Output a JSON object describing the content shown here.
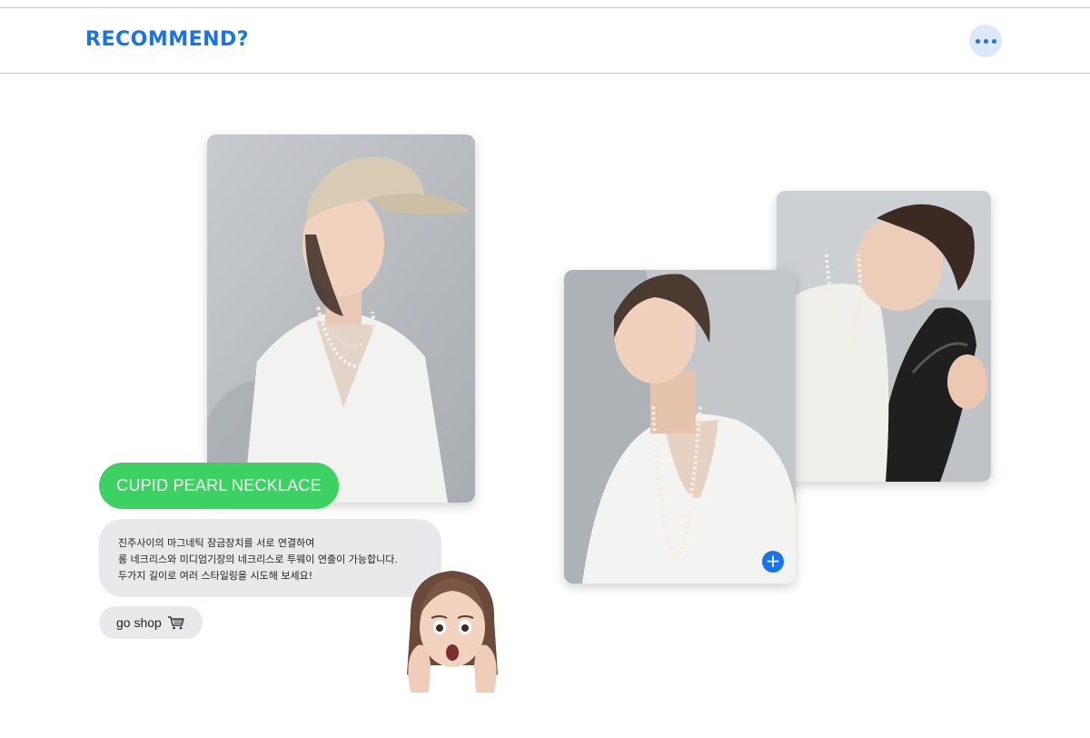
{
  "header": {
    "title": "RECOMMEND?",
    "more_icon": "more-horizontal-icon"
  },
  "colors": {
    "accent": "#1a73e8",
    "product_pill": "#3dd163",
    "bubble": "#e9e9eb"
  },
  "product": {
    "name": "CUPID PEARL NECKLACE",
    "description_lines": [
      "진주사이의  마그네틱 잠금장치를 서로 연결하여",
      "롱 네크리스와 미디엄기장의 네크리스로  투웨이 연출이 가능합니다.",
      "두가지 길이로 여러 스타일링을 시도해 보세요!"
    ],
    "cta_label": "go shop",
    "cta_icon": "shopping-cart-icon"
  },
  "gallery": {
    "photos": [
      "model-photo",
      "model-photo",
      "model-photo"
    ],
    "add_icon": "plus-icon"
  },
  "decoration": {
    "sticker": "surprised-memoji-face"
  }
}
